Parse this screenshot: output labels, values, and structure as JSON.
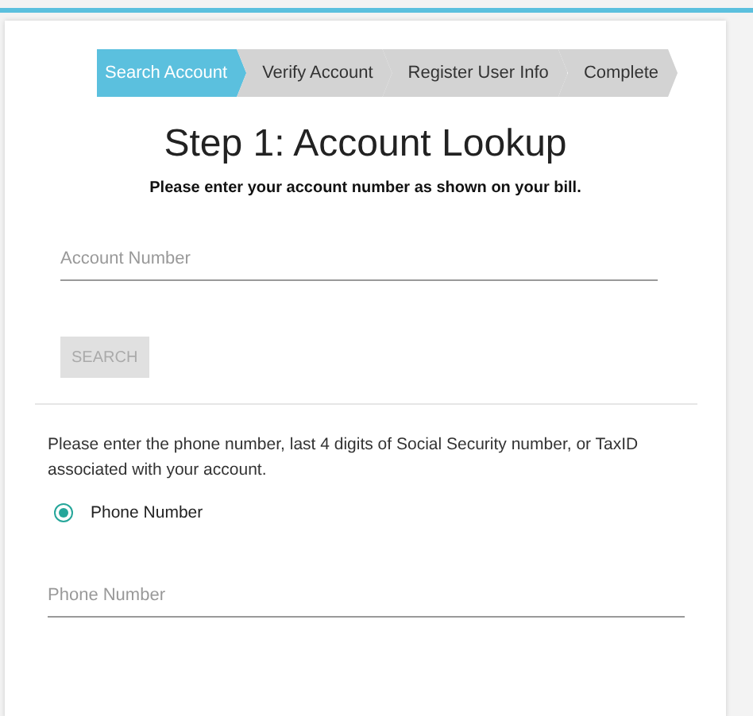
{
  "steps": [
    {
      "label": "Search Account",
      "selected": true
    },
    {
      "label": "Verify Account",
      "selected": false
    },
    {
      "label": "Register User Info",
      "selected": false
    },
    {
      "label": "Complete",
      "selected": false
    }
  ],
  "title": "Step 1: Account Lookup",
  "subtitle": "Please enter your account number as shown on your bill.",
  "account_field": {
    "placeholder": "Account Number"
  },
  "search_button": {
    "label": "SEARCH",
    "disabled": true
  },
  "instructions": "Please enter the phone number, last 4 digits of Social Security number, or TaxID associated with your account.",
  "options": [
    {
      "label": "Phone Number",
      "selected": true
    }
  ],
  "phone_field": {
    "placeholder": "Phone Number"
  }
}
